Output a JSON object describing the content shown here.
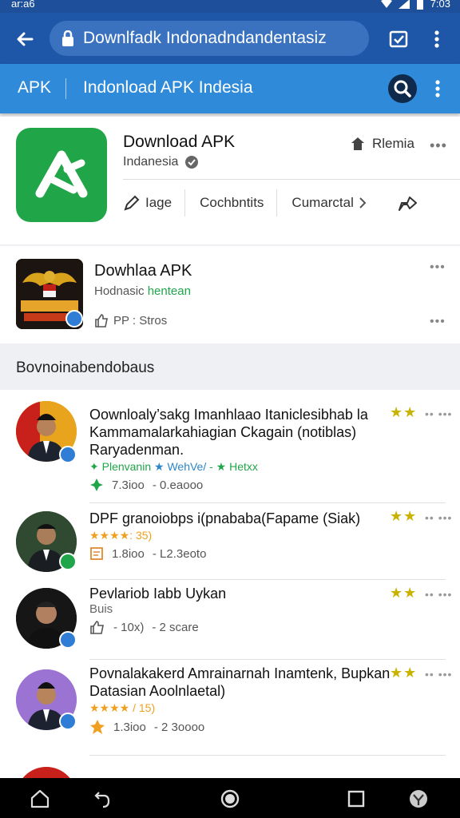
{
  "status": {
    "left": "ar:a6",
    "right": "7:03"
  },
  "browser": {
    "url": "Downlfadk Indonadndandentasiz"
  },
  "appbar": {
    "brand": "APK",
    "title": "Indonload APK Indesia"
  },
  "hero": {
    "name": "Download APK",
    "subtitle": "Indanesia",
    "right_tag": "Rlemia",
    "more": "•••",
    "actions": [
      "Iage",
      "Cochbntits",
      "Cumarctal"
    ]
  },
  "promo": {
    "name": "Dowhlaa APK",
    "sub_text": "Hodnasic",
    "sub_green": "hentean",
    "meta": "PP : Stros",
    "dots": "•••",
    "dots2": "•••"
  },
  "section_heading": "Bovnoinabendobaus",
  "items": [
    {
      "title": "Oownloaly’sakg Imanhlaao Itaniclesibhab la Kammamalarkahiagian Ckagain (notiblas) Raryadenman.",
      "tagline_a": "✦ Plenvanin",
      "tagline_b": "★ WehVe/",
      "tagline_c": "- ★ Hetxx",
      "meta_a": "7.3ioo",
      "meta_b": "- 0.eaooo",
      "right_stars": "★★",
      "right_dots": "•• •••",
      "badge_color": "#2f7dd4"
    },
    {
      "title": "DPF granoiobps i(pnababa(Fapame (Siak)",
      "stars_text": "★★★★: 35)",
      "meta_a": "1.8ioo",
      "meta_b": "- L2.3eoto",
      "right_stars": "★★",
      "right_dots": "•• •••",
      "badge_color": "#21a54a"
    },
    {
      "title": "Pevlariob Iabb Uykan",
      "sub": "Buis",
      "meta_a": "- 10x)",
      "meta_b": "- 2 scare",
      "right_stars": "★★",
      "right_dots": "•• •••",
      "badge_color": "#2f7dd4"
    },
    {
      "title": "Povnalakakerd Amrainarnah Inamtenk, Bupkan Datasian Aoolnlaetal)",
      "stars_text": "★★★★ / 15)",
      "meta_a": "1.3ioo",
      "meta_b": "- 2 3oooo",
      "right_stars": "★★",
      "right_dots": "•• •••",
      "badge_color": "#2f7dd4"
    }
  ],
  "colors": {
    "urlbar": "#1e57a8",
    "appbar": "#2f8bd9",
    "app_icon_green": "#20a649",
    "star_yellow": "#c8b400",
    "star_orange": "#f0a020"
  }
}
